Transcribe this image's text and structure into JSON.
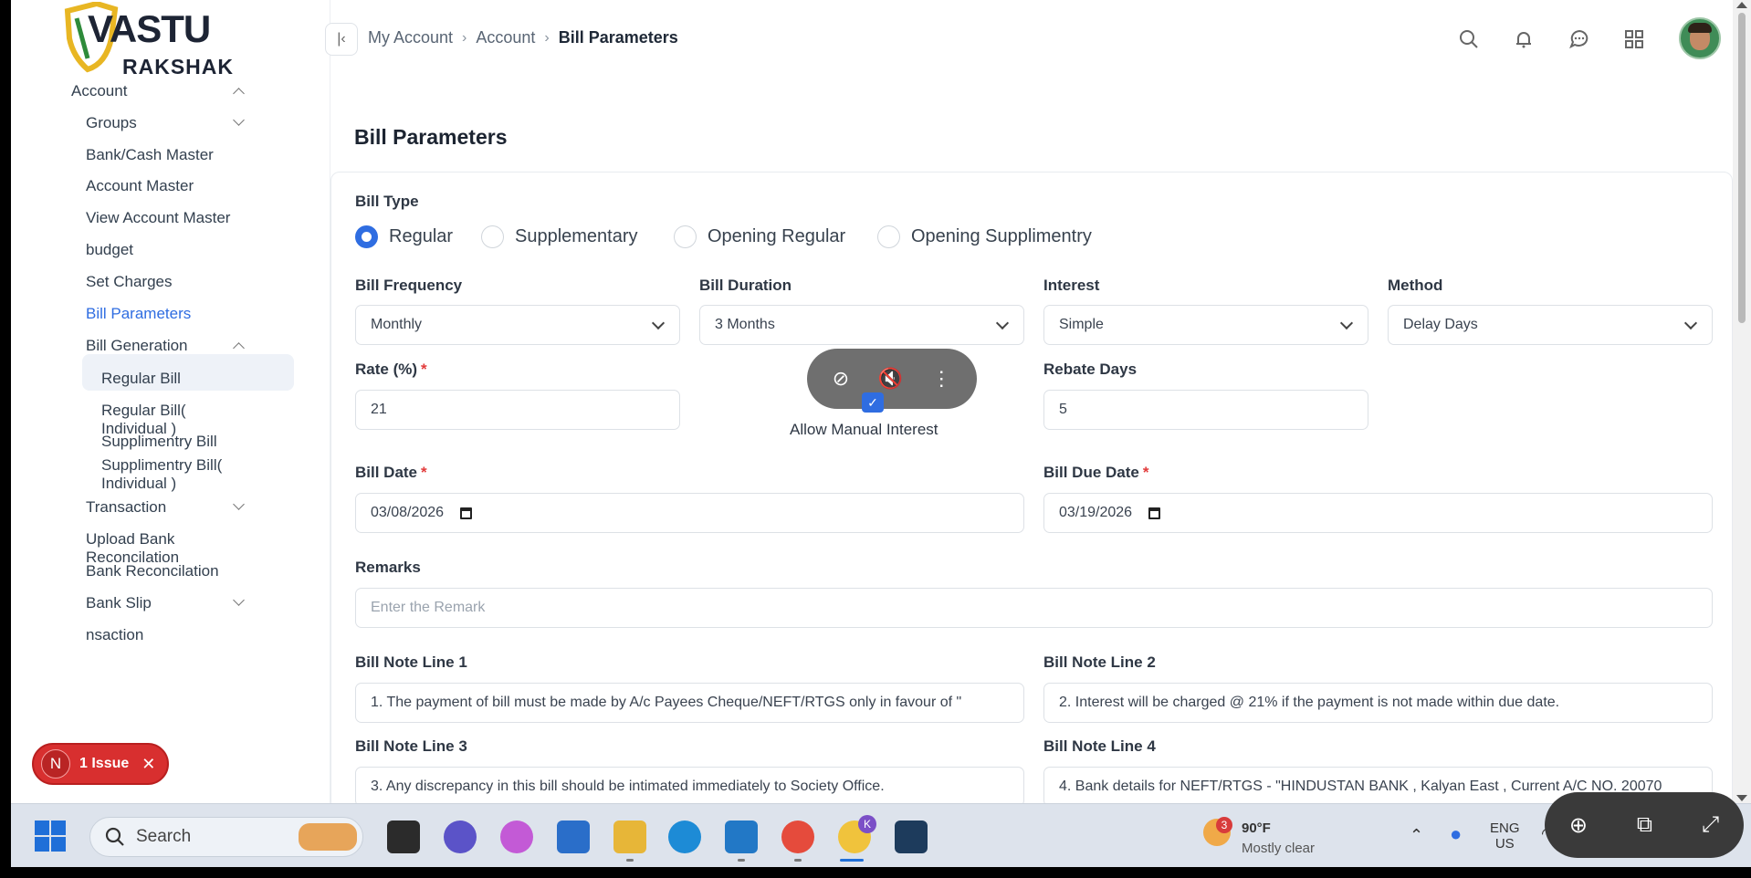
{
  "logo": {
    "line1": "VASTU",
    "line2": "RAKSHAK"
  },
  "sidebar": {
    "items": [
      {
        "label": "Account",
        "indent": 1,
        "chevron": "up"
      },
      {
        "label": "Groups",
        "indent": 2,
        "chevron": "down"
      },
      {
        "label": "Bank/Cash Master",
        "indent": 2
      },
      {
        "label": "Account Master",
        "indent": 2
      },
      {
        "label": "View Account Master",
        "indent": 2
      },
      {
        "label": "budget",
        "indent": 2
      },
      {
        "label": "Set Charges",
        "indent": 2
      },
      {
        "label": "Bill Parameters",
        "indent": 2,
        "active": true
      },
      {
        "label": "Bill Generation",
        "indent": 2,
        "chevron": "up"
      },
      {
        "label": "Regular Bill",
        "indent": 3
      },
      {
        "label": "Regular Bill( Individual )",
        "indent": 3
      },
      {
        "label": "Supplimentry Bill",
        "indent": 3
      },
      {
        "label": "Supplimentry Bill( Individual )",
        "indent": 3
      },
      {
        "label": "Transaction",
        "indent": 2,
        "chevron": "down"
      },
      {
        "label": "Upload Bank Reconcilation",
        "indent": 2
      },
      {
        "label": "Bank Reconcilation",
        "indent": 2
      },
      {
        "label": "Bank Slip",
        "indent": 2,
        "chevron": "down"
      },
      {
        "label": "nsaction",
        "indent": 2
      }
    ]
  },
  "breadcrumb": [
    "My Account",
    "Account",
    "Bill Parameters"
  ],
  "page_title": "Bill Parameters",
  "form": {
    "bill_type_label": "Bill Type",
    "bill_types": [
      "Regular",
      "Supplementary",
      "Opening Regular",
      "Opening Supplimentry"
    ],
    "bill_type_selected": "Regular",
    "bill_frequency": {
      "label": "Bill Frequency",
      "value": "Monthly"
    },
    "bill_duration": {
      "label": "Bill Duration",
      "value": "3 Months"
    },
    "interest": {
      "label": "Interest",
      "value": "Simple"
    },
    "method": {
      "label": "Method",
      "value": "Delay Days"
    },
    "rate": {
      "label": "Rate (%)",
      "value": "21"
    },
    "allow_manual_interest": {
      "label": "Allow Manual Interest",
      "checked": true
    },
    "rebate_days": {
      "label": "Rebate Days",
      "value": "5"
    },
    "bill_date": {
      "label": "Bill Date",
      "value": "03/08/2026"
    },
    "bill_due_date": {
      "label": "Bill Due Date",
      "value": "03/19/2026"
    },
    "remarks": {
      "label": "Remarks",
      "placeholder": "Enter the Remark"
    },
    "note1": {
      "label": "Bill Note Line 1",
      "value": "1. The payment of bill must be made by A/c Payees Cheque/NEFT/RTGS only in favour of \""
    },
    "note2": {
      "label": "Bill Note Line 2",
      "value": "2. Interest will be charged @ 21% if the payment is not made within due date."
    },
    "note3": {
      "label": "Bill Note Line 3",
      "value": "3. Any discrepancy in this bill should be intimated immediately to Society Office."
    },
    "note4": {
      "label": "Bill Note Line 4",
      "value": "4. Bank details for NEFT/RTGS - \"HINDUSTAN BANK , Kalyan East , Current A/C NO. 20070"
    }
  },
  "issue_badge": {
    "initial": "N",
    "text": "1 Issue"
  },
  "taskbar": {
    "search_label": "Search",
    "weather_temp": "90°F",
    "weather_desc": "Mostly clear",
    "weather_badge": "3",
    "lang_top": "ENG",
    "lang_bottom": "US",
    "chrome_profile_badge": "K"
  },
  "colors": {
    "accent": "#2f6de1",
    "required": "#e23b3b",
    "issue": "#d82f2f"
  }
}
